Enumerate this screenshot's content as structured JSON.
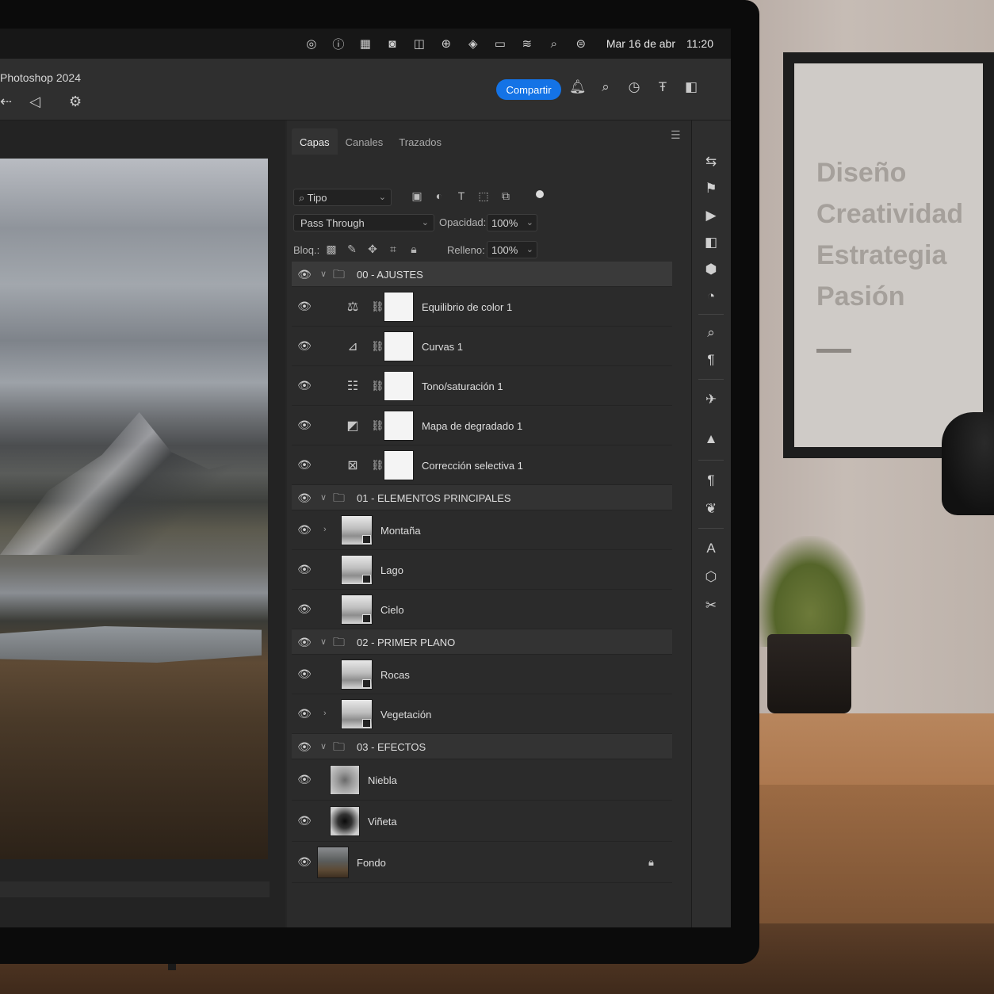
{
  "menubar": {
    "icons": [
      "status-circle-icon",
      "info-icon",
      "calendar-icon",
      "screen-record-icon",
      "camera-icon",
      "download-icon",
      "audio-icon",
      "battery-icon",
      "wifi-icon",
      "spotlight-icon",
      "control-center-icon"
    ],
    "date": "Mar 16 de abr",
    "time": "11:20"
  },
  "app": {
    "title": "Photoshop 2024",
    "share_label": "Compartir"
  },
  "panel": {
    "tabs": [
      {
        "label": "Capas",
        "active": true
      },
      {
        "label": "Canales",
        "active": false
      },
      {
        "label": "Trazados",
        "active": false
      }
    ],
    "filter": {
      "label": "Tipo"
    },
    "blend_mode": "Pass Through",
    "opacity_label": "Opacidad:",
    "opacity_value": "100%",
    "lock_label": "Bloq.:",
    "fill_label": "Relleno:",
    "fill_value": "100%"
  },
  "layers": {
    "g0": "00 - AJUSTES",
    "l1": "Equilibrio de color 1",
    "l2": "Curvas 1",
    "l3": "Tono/saturación 1",
    "l4": "Mapa de degradado 1",
    "l5": "Corrección selectiva 1",
    "g1": "01 - ELEMENTOS PRINCIPALES",
    "l6": "Montaña",
    "l7": "Lago",
    "l8": "Cielo",
    "g2": "02 - PRIMER PLANO",
    "l9": "Rocas",
    "l10": "Vegetación",
    "g3": "03 - EFECTOS",
    "l11": "Niebla",
    "l12": "Viñeta",
    "l13": "Fondo"
  },
  "poster": {
    "lines": [
      "Diseño",
      "Creatividad",
      "Estrategia",
      "Pasión"
    ]
  },
  "colors": {
    "accent": "#1473e6",
    "panel_bg": "#2b2b2b",
    "group_bg": "#333333"
  }
}
